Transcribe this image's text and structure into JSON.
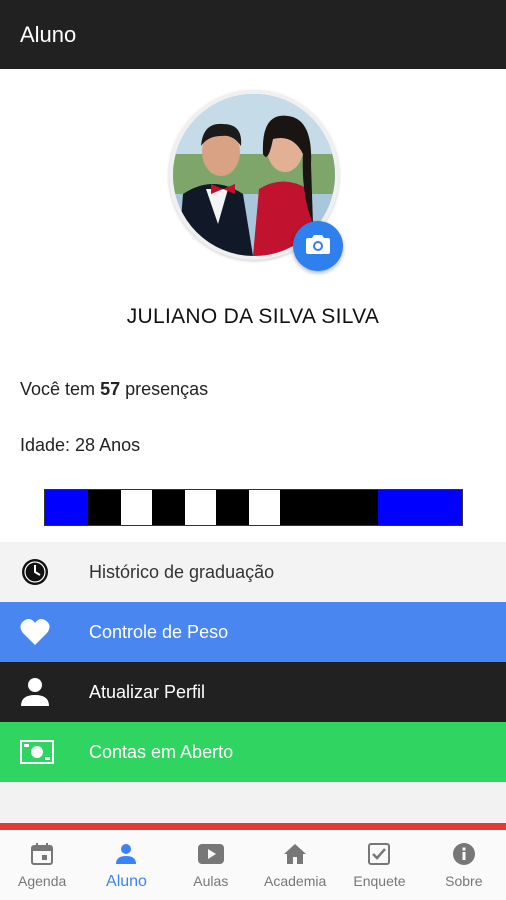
{
  "appbar": {
    "title": "Aluno"
  },
  "profile": {
    "name": "JULIANO DA SILVA SILVA",
    "presence_prefix": "Você tem",
    "presence_count": "57",
    "presence_suffix": "presenças",
    "age": "Idade: 28 Anos",
    "camera_icon": "camera-icon"
  },
  "belt": {
    "colors": {
      "blue": "#0000ff",
      "black": "#000000",
      "white": "#ffffff"
    }
  },
  "menu": [
    {
      "label": "Histórico de graduação",
      "icon": "clock-icon"
    },
    {
      "label": "Controle de Peso",
      "icon": "heart-icon"
    },
    {
      "label": "Atualizar Perfil",
      "icon": "person-icon"
    },
    {
      "label": "Contas em Aberto",
      "icon": "money-icon"
    }
  ],
  "bottom_nav": [
    {
      "label": "Agenda",
      "icon": "calendar-icon"
    },
    {
      "label": "Aluno",
      "icon": "person-icon",
      "active": true
    },
    {
      "label": "Aulas",
      "icon": "video-icon"
    },
    {
      "label": "Academia",
      "icon": "home-icon"
    },
    {
      "label": "Enquete",
      "icon": "checkbox-icon"
    },
    {
      "label": "Sobre",
      "icon": "info-icon"
    }
  ],
  "colors": {
    "appbar": "#212121",
    "accent_blue": "#4a86f0",
    "accent_green": "#2fd560",
    "accent_red": "#e53935",
    "nav_active": "#3b82f6"
  }
}
